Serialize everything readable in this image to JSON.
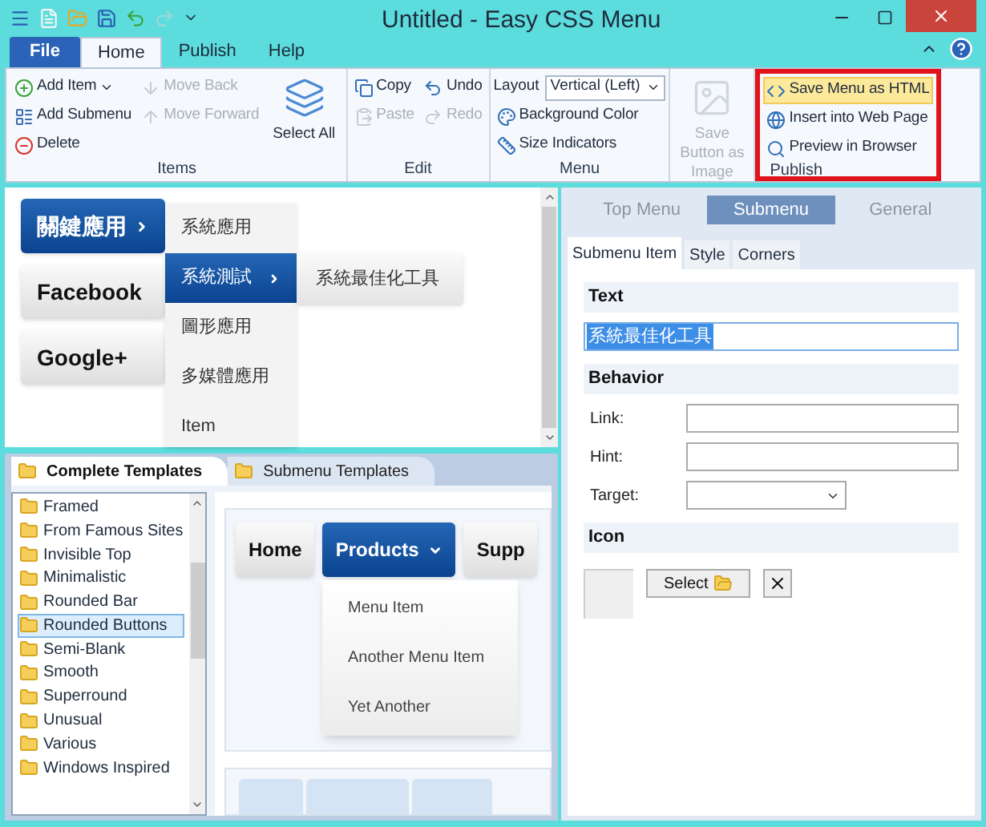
{
  "window": {
    "title": "Untitled - Easy CSS Menu"
  },
  "ribbon": {
    "tabs": [
      {
        "label": "File",
        "kind": "file",
        "selected": false
      },
      {
        "label": "Home",
        "kind": "tab",
        "selected": true
      },
      {
        "label": "Publish",
        "kind": "tab",
        "selected": false
      },
      {
        "label": "Help",
        "kind": "tab",
        "selected": false
      }
    ],
    "groups": [
      {
        "label": "Items",
        "highlighted": false,
        "columns": [
          [
            {
              "label": "Add Item",
              "kind": "dropdown",
              "disabled": false
            },
            {
              "label": "Add Submenu",
              "kind": "small",
              "disabled": false
            },
            {
              "label": "Delete",
              "kind": "small",
              "disabled": false
            }
          ],
          [
            {
              "label": "Move Back",
              "kind": "small",
              "disabled": true
            },
            {
              "label": "Move Forward",
              "kind": "small",
              "disabled": true
            }
          ],
          [
            {
              "label": "Select All",
              "kind": "large",
              "disabled": false
            }
          ]
        ]
      },
      {
        "label": "Edit",
        "highlighted": false,
        "columns": [
          [
            {
              "label": "Copy",
              "kind": "small",
              "disabled": false
            },
            {
              "label": "Paste",
              "kind": "small",
              "disabled": true
            }
          ],
          [
            {
              "label": "Undo",
              "kind": "small",
              "disabled": false
            },
            {
              "label": "Redo",
              "kind": "small",
              "disabled": true
            }
          ]
        ]
      },
      {
        "label": "Menu",
        "highlighted": false,
        "columns": [
          [
            {
              "label": "Layout",
              "kind": "select",
              "value": "Vertical (Left)",
              "disabled": false
            },
            {
              "label": "Background Color",
              "kind": "small",
              "disabled": false
            },
            {
              "label": "Size Indicators",
              "kind": "small",
              "disabled": false
            }
          ]
        ]
      },
      {
        "highlighted": false,
        "columns": [
          [
            {
              "label": "Save Button as Image",
              "kind": "large",
              "disabled": true
            }
          ]
        ]
      },
      {
        "label": "Publish",
        "highlighted": true,
        "columns": [
          [
            {
              "label": "Save Menu as HTML",
              "kind": "small",
              "disabled": false,
              "selected": true
            },
            {
              "label": "Insert into Web Page",
              "kind": "small",
              "disabled": false,
              "selected": false
            },
            {
              "label": "Preview in Browser",
              "kind": "small",
              "disabled": false,
              "selected": false
            }
          ]
        ]
      }
    ]
  },
  "preview": {
    "menu": [
      {
        "label": "關鍵應用",
        "selected": true,
        "has_submenu": true
      },
      {
        "label": "Facebook",
        "selected": false,
        "has_submenu": false
      },
      {
        "label": "Google+",
        "selected": false,
        "has_submenu": false
      }
    ],
    "submenu": [
      {
        "label": "系統應用",
        "selected": false,
        "has_submenu": false
      },
      {
        "label": "系統測試",
        "selected": true,
        "has_submenu": true
      },
      {
        "label": "圖形應用",
        "selected": false,
        "has_submenu": false
      },
      {
        "label": "多媒體應用",
        "selected": false,
        "has_submenu": false
      },
      {
        "label": "Item",
        "selected": false,
        "has_submenu": false
      }
    ],
    "sub_submenu": [
      {
        "label": "系統最佳化工具",
        "selected": false
      }
    ]
  },
  "templates": {
    "tabs": [
      {
        "label": "Complete Templates",
        "selected": true
      },
      {
        "label": "Submenu Templates",
        "selected": false
      }
    ],
    "list": [
      {
        "label": "Framed",
        "selected": false
      },
      {
        "label": "From Famous Sites",
        "selected": false
      },
      {
        "label": "Invisible Top",
        "selected": false
      },
      {
        "label": "Minimalistic",
        "selected": false
      },
      {
        "label": "Rounded Bar",
        "selected": false
      },
      {
        "label": "Rounded Buttons",
        "selected": true
      },
      {
        "label": "Semi-Blank",
        "selected": false
      },
      {
        "label": "Smooth",
        "selected": false
      },
      {
        "label": "Superround",
        "selected": false
      },
      {
        "label": "Unusual",
        "selected": false
      },
      {
        "label": "Various",
        "selected": false
      },
      {
        "label": "Windows Inspired",
        "selected": false
      }
    ],
    "sample": {
      "buttons": [
        {
          "label": "Home",
          "selected": false,
          "has_dropdown": false
        },
        {
          "label": "Products",
          "selected": true,
          "has_dropdown": true
        },
        {
          "label": "Supp",
          "selected": false,
          "has_dropdown": false
        }
      ],
      "dropdown": [
        "Menu Item",
        "Another Menu Item",
        "Yet Another"
      ]
    }
  },
  "properties": {
    "tabs": [
      {
        "label": "Top Menu",
        "selected": false
      },
      {
        "label": "Submenu",
        "selected": true
      },
      {
        "label": "General",
        "selected": false
      }
    ],
    "subtabs": [
      {
        "label": "Submenu Item",
        "selected": true
      },
      {
        "label": "Style",
        "selected": false
      },
      {
        "label": "Corners",
        "selected": false
      }
    ],
    "sections": [
      {
        "title": "Text",
        "fields": [
          {
            "kind": "text",
            "value": "系統最佳化工具",
            "selected": true
          }
        ]
      },
      {
        "title": "Behavior",
        "fields": [
          {
            "kind": "labeled",
            "label": "Link:"
          },
          {
            "kind": "labeled",
            "label": "Hint:"
          },
          {
            "kind": "select",
            "label": "Target:"
          }
        ]
      },
      {
        "title": "Icon",
        "fields": [
          {
            "kind": "icon",
            "button": "Select"
          }
        ]
      }
    ]
  }
}
